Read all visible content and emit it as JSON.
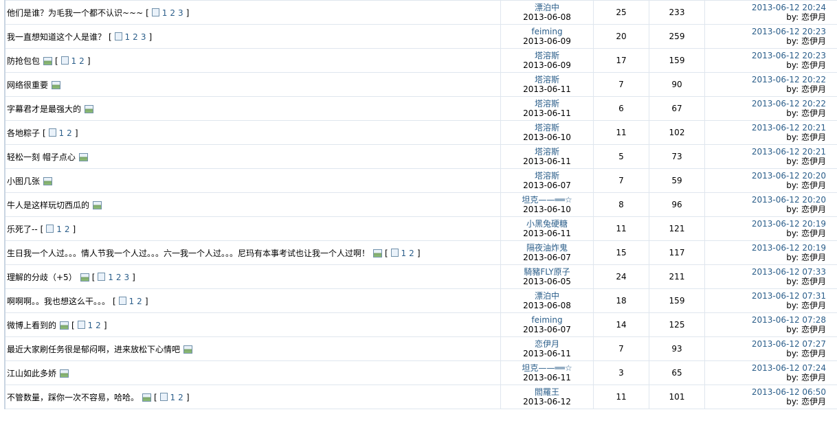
{
  "topics": [
    {
      "title": "他们是谁？为毛我一个都不认识~~~",
      "has_image": false,
      "pages": [
        "1",
        "2",
        "3"
      ],
      "author": "漂泊中",
      "date": "2013-06-08",
      "replies": "25",
      "views": "233",
      "last_time": "2013-06-12 20:24",
      "last_by": "by:",
      "last_user": "恋伊月"
    },
    {
      "title": "我一直想知道这个人是谁？",
      "has_image": false,
      "pages": [
        "1",
        "2",
        "3"
      ],
      "author": "feiming",
      "date": "2013-06-09",
      "replies": "20",
      "views": "259",
      "last_time": "2013-06-12 20:23",
      "last_by": "by:",
      "last_user": "恋伊月"
    },
    {
      "title": "防抢包包",
      "has_image": true,
      "pages": [
        "1",
        "2"
      ],
      "author": "塔溶斯",
      "date": "2013-06-09",
      "replies": "17",
      "views": "159",
      "last_time": "2013-06-12 20:23",
      "last_by": "by:",
      "last_user": "恋伊月"
    },
    {
      "title": "网络很重要",
      "has_image": true,
      "pages": [],
      "author": "塔溶斯",
      "date": "2013-06-11",
      "replies": "7",
      "views": "90",
      "last_time": "2013-06-12 20:22",
      "last_by": "by:",
      "last_user": "恋伊月"
    },
    {
      "title": "字幕君才是最强大的",
      "has_image": true,
      "pages": [],
      "author": "塔溶斯",
      "date": "2013-06-11",
      "replies": "6",
      "views": "67",
      "last_time": "2013-06-12 20:22",
      "last_by": "by:",
      "last_user": "恋伊月"
    },
    {
      "title": "各地粽子",
      "has_image": false,
      "pages": [
        "1",
        "2"
      ],
      "author": "塔溶斯",
      "date": "2013-06-10",
      "replies": "11",
      "views": "102",
      "last_time": "2013-06-12 20:21",
      "last_by": "by:",
      "last_user": "恋伊月"
    },
    {
      "title": "轻松一刻  帽子点心",
      "has_image": true,
      "pages": [],
      "author": "塔溶斯",
      "date": "2013-06-11",
      "replies": "5",
      "views": "73",
      "last_time": "2013-06-12 20:21",
      "last_by": "by:",
      "last_user": "恋伊月"
    },
    {
      "title": "小图几张",
      "has_image": true,
      "pages": [],
      "author": "塔溶斯",
      "date": "2013-06-07",
      "replies": "7",
      "views": "59",
      "last_time": "2013-06-12 20:20",
      "last_by": "by:",
      "last_user": "恋伊月"
    },
    {
      "title": "牛人是这样玩切西瓜的",
      "has_image": true,
      "pages": [],
      "author": "坦克——══☆",
      "date": "2013-06-10",
      "replies": "8",
      "views": "96",
      "last_time": "2013-06-12 20:20",
      "last_by": "by:",
      "last_user": "恋伊月"
    },
    {
      "title": "乐死了--",
      "has_image": false,
      "pages": [
        "1",
        "2"
      ],
      "author": "小黑兔硬糖",
      "date": "2013-06-11",
      "replies": "11",
      "views": "121",
      "last_time": "2013-06-12 20:19",
      "last_by": "by:",
      "last_user": "恋伊月"
    },
    {
      "title": "生日我一个人过。。。情人节我一个人过。。。六一我一个人过。。。尼玛有本事考试也让我一个人过啊！",
      "has_image": true,
      "pages": [
        "1",
        "2"
      ],
      "author": "隔夜油炸鬼",
      "date": "2013-06-07",
      "replies": "15",
      "views": "117",
      "last_time": "2013-06-12 20:19",
      "last_by": "by:",
      "last_user": "恋伊月"
    },
    {
      "title": "理解的分歧（+5）",
      "has_image": true,
      "pages": [
        "1",
        "2",
        "3"
      ],
      "author": "騎豬FLY原子",
      "date": "2013-06-05",
      "replies": "24",
      "views": "211",
      "last_time": "2013-06-12 07:33",
      "last_by": "by:",
      "last_user": "恋伊月"
    },
    {
      "title": "啊啊啊。。我也想这么干。。。",
      "has_image": false,
      "pages": [
        "1",
        "2"
      ],
      "author": "漂泊中",
      "date": "2013-06-08",
      "replies": "18",
      "views": "159",
      "last_time": "2013-06-12 07:31",
      "last_by": "by:",
      "last_user": "恋伊月"
    },
    {
      "title": "微博上看到的",
      "has_image": true,
      "pages": [
        "1",
        "2"
      ],
      "author": "feiming",
      "date": "2013-06-07",
      "replies": "14",
      "views": "125",
      "last_time": "2013-06-12 07:28",
      "last_by": "by:",
      "last_user": "恋伊月"
    },
    {
      "title": "最近大家刷任务很是郁闷啊，进来放松下心情吧",
      "has_image": true,
      "pages": [],
      "author": "恋伊月",
      "date": "2013-06-11",
      "replies": "7",
      "views": "93",
      "last_time": "2013-06-12 07:27",
      "last_by": "by:",
      "last_user": "恋伊月"
    },
    {
      "title": "江山如此多娇",
      "has_image": true,
      "pages": [],
      "author": "坦克——══☆",
      "date": "2013-06-11",
      "replies": "3",
      "views": "65",
      "last_time": "2013-06-12 07:24",
      "last_by": "by:",
      "last_user": "恋伊月"
    },
    {
      "title": "不管数量，踩你一次不容易，哈哈。",
      "has_image": true,
      "pages": [
        "1",
        "2"
      ],
      "author": "閻羅王",
      "date": "2013-06-12",
      "replies": "11",
      "views": "101",
      "last_time": "2013-06-12 06:50",
      "last_by": "by:",
      "last_user": "恋伊月"
    }
  ],
  "pager_open": "[",
  "pager_close": "]",
  "icons": {
    "image": "image-attachment-icon",
    "multipage": "multipage-icon"
  },
  "colors": {
    "link": "#2b5e8a",
    "border": "#dfe6ee"
  }
}
